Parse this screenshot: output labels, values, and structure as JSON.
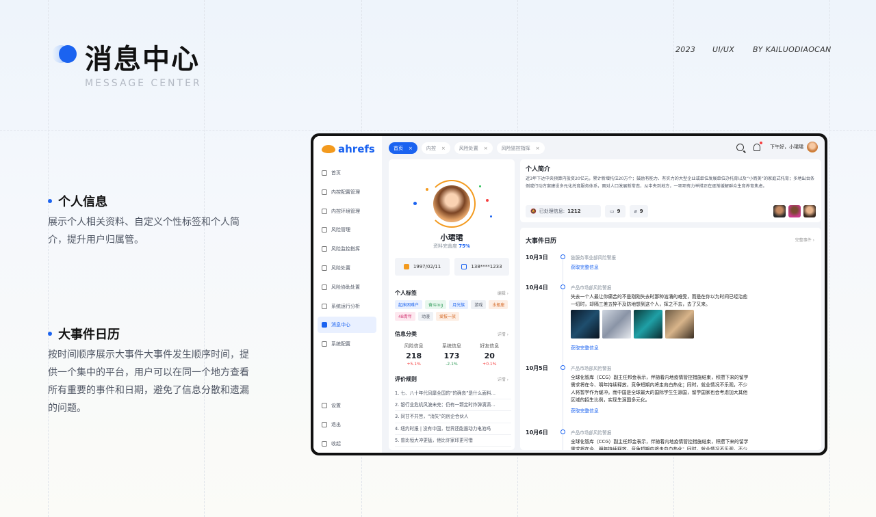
{
  "header": {
    "title": "消息中心",
    "subtitle": "MESSAGE CENTER",
    "year": "2023",
    "category": "UI/UX",
    "author": "BY KAILUODIAOCAN"
  },
  "sections": [
    {
      "title": "个人信息",
      "desc": "展示个人相关资料、自定义个性标签和个人简介，提升用户归属管。"
    },
    {
      "title": "大事件日历",
      "desc": "按时间顺序展示大事件大事件发生顺序时间，提供一个集中的平台，用户可以在同一个地方查看所有重要的事件和日期，避免了信息分散和遗漏的问题。"
    }
  ],
  "app": {
    "logo": "ahrefs",
    "nav": [
      "首页",
      "内控配置管理",
      "内控环境管理",
      "风险管理",
      "风险监控指挥",
      "风险处置",
      "风险协助处置",
      "系统运行分析",
      "消息中心",
      "系统配置"
    ],
    "nav_active": 8,
    "nav_bottom": [
      "设置",
      "退出",
      "收起"
    ],
    "tabs": [
      "首页",
      "内控",
      "风险处置",
      "风险监控指挥"
    ],
    "tab_close": "×",
    "greeting": "下午好，小珺珺",
    "profile": {
      "name": "小珺珺",
      "completeness_label": "资料完善度",
      "completeness": "75%",
      "birthday": "1997/02/11",
      "phone": "138****1233",
      "tags_title": "个人标签",
      "tags_more": "编辑 ›",
      "tags": [
        "起床困难户",
        "奋斗ing",
        "月光族",
        "游戏",
        "水瓶座",
        "4B青年",
        "动漫",
        "爱拔一族"
      ],
      "stats_title": "信息分类",
      "stats_more": "详情 ›",
      "stats": [
        {
          "label": "风险信息",
          "value": "218",
          "delta": "+5.1%"
        },
        {
          "label": "系统信息",
          "value": "173",
          "delta": "-2.1%"
        },
        {
          "label": "好友信息",
          "value": "20",
          "delta": "+0.1%"
        }
      ],
      "rules_title": "评价规则",
      "rules_more": "详情 ›",
      "rules": [
        "1. 七、八十年代风靡全国的“的确良”是什么面料…",
        "2. 银行业危机风波未完：仍有一颗定时炸弹滴滴…",
        "3. 同甘不共苦，“消失”的房企合伙人",
        "4. 纽约时报 | 没有中国，世界还能遏动力电池吗",
        "5. 曾比恒大冲更猛，他比许家印更可惜"
      ]
    },
    "intro": {
      "title": "个人简介",
      "text": "近3年下达中央预算内投资20亿元，累计新增托位20万个；鼓励有能力、有实力的大型企业或单位发展单位办托育以及“小而美”的家庭式托育；多地出台条例或行动方案建设多元化托育服务体系，面对人口发展新常态，从中央到地方，一项项有力举措正在逐渐缓解群众生育养育焦虑。",
      "processed_label": "已处理信息:",
      "processed_value": "1212",
      "comments": "9",
      "attachments": "9"
    },
    "calendar": {
      "title": "大事件日历",
      "more": "完整事件 ›",
      "link": "获取完整信息",
      "events": [
        {
          "date": "10月3日",
          "category": "链服务事业部风险警报",
          "body": ""
        },
        {
          "date": "10月4日",
          "category": "产品市场部风险警报",
          "body": "失去一个人最让你痛苦的不是刚刚失去时那种汹涌的难受，而是在你以为时间已经治愈一切时，却隔三差五猝不及防地想到这个人，挥之不去，去了又来。"
        },
        {
          "date": "10月5日",
          "category": "产品市场部风险警报",
          "body": "全球化智库（CCG）副主任邦金表示，伴随着内地疫情管控措施结束，积攒下来的留学需求将在今、明年持续释放，竞争短期内将走向白热化；同时，就业情况不乐观，不少人将暂学作为缓冲。而中国是全球最大的国际学生生源国，留学国家也会考虑加大其他区域的招生比例，实现生源国多元化。"
        },
        {
          "date": "10月6日",
          "category": "产品市场部风险警报",
          "body": "全球化智库（CCG）副主任邦金表示，伴随着内地疫情管控措施结束，积攒下来的留学需求将在今、明年持续释放，竞争短期内将走向白热化；同时，就业情况不乐观，不少人将暂学作为缓冲。"
        }
      ]
    }
  }
}
